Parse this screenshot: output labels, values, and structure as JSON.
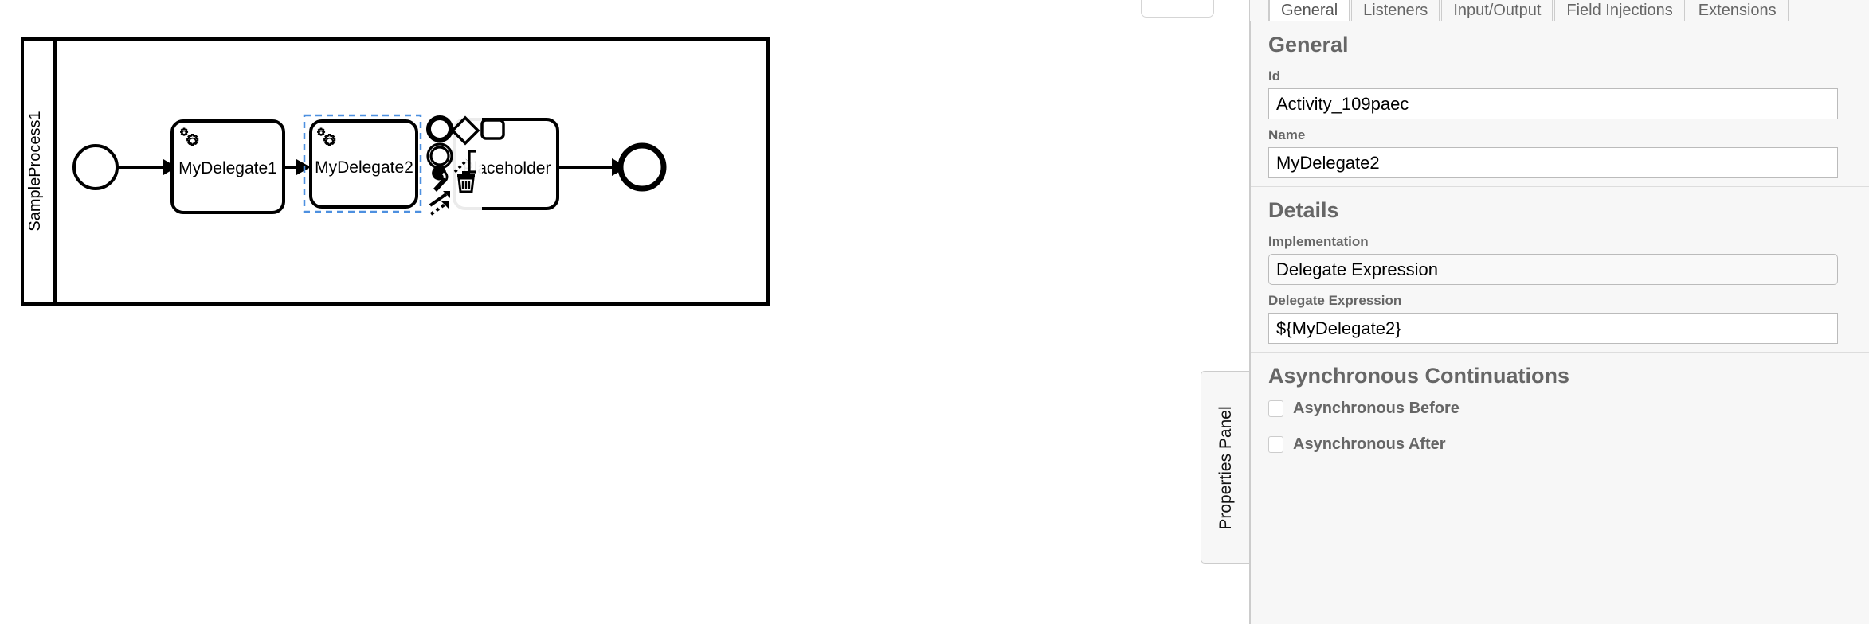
{
  "canvas": {
    "pool": {
      "label": "SampleProcess1"
    },
    "elements": [
      {
        "type": "start-event",
        "label": ""
      },
      {
        "type": "service-task",
        "label": "MyDelegate1"
      },
      {
        "type": "service-task",
        "label": "MyDelegate2",
        "selected": true
      },
      {
        "type": "task",
        "label": "Placeholder"
      },
      {
        "type": "end-event",
        "label": ""
      }
    ],
    "selection_color": "#4d90e0",
    "context_pad": {
      "items": [
        {
          "name": "append-end-event",
          "icon": "circle-thick-icon"
        },
        {
          "name": "append-gateway",
          "icon": "diamond-icon"
        },
        {
          "name": "append-intermediate-event",
          "icon": "double-circle-icon"
        },
        {
          "name": "append-task",
          "icon": "rounded-rect-icon"
        },
        {
          "name": "change-type",
          "icon": "wrench-icon"
        },
        {
          "name": "append-text-annotation",
          "icon": "text-annotation-icon"
        },
        {
          "name": "connect",
          "icon": "connect-arrows-icon"
        },
        {
          "name": "delete",
          "icon": "trash-icon"
        }
      ]
    }
  },
  "panel": {
    "handle_label": "Properties Panel",
    "tabs": [
      {
        "label": "General",
        "active": true
      },
      {
        "label": "Listeners",
        "active": false
      },
      {
        "label": "Input/Output",
        "active": false
      },
      {
        "label": "Field Injections",
        "active": false
      },
      {
        "label": "Extensions",
        "active": false
      }
    ],
    "groups": [
      {
        "title": "General",
        "fields": [
          {
            "label": "Id",
            "value": "Activity_109paec",
            "kind": "text"
          },
          {
            "label": "Name",
            "value": "MyDelegate2",
            "kind": "text"
          }
        ]
      },
      {
        "title": "Details",
        "fields": [
          {
            "label": "Implementation",
            "value": "Delegate Expression",
            "kind": "select"
          },
          {
            "label": "Delegate Expression",
            "value": "${MyDelegate2}",
            "kind": "text"
          }
        ]
      },
      {
        "title": "Asynchronous Continuations",
        "checkboxes": [
          {
            "label": "Asynchronous Before",
            "checked": false
          },
          {
            "label": "Asynchronous After",
            "checked": false
          }
        ]
      }
    ]
  }
}
